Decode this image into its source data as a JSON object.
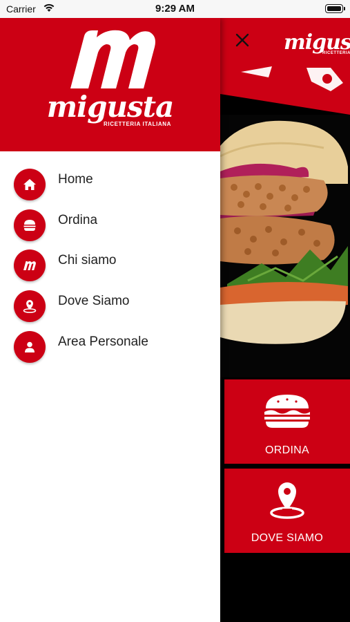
{
  "status_bar": {
    "carrier": "Carrier",
    "time": "9:29 AM"
  },
  "brand": {
    "primary_color": "#cc0014",
    "logo_mark": "m",
    "logo_word": "migusta",
    "logo_tagline": "RICETTERIA ITALIANA"
  },
  "drawer": {
    "menu": [
      {
        "label": "Home",
        "icon": "home-icon"
      },
      {
        "label": "Ordina",
        "icon": "burger-icon"
      },
      {
        "label": "Chi siamo",
        "icon": "logo-m-icon"
      },
      {
        "label": "Dove Siamo",
        "icon": "location-pin-icon"
      },
      {
        "label": "Area Personale",
        "icon": "user-icon"
      }
    ]
  },
  "main": {
    "close_icon": "close-icon",
    "tiles": [
      {
        "label": "ORDINA",
        "icon": "burger-icon"
      },
      {
        "label": "DOVE SIAMO",
        "icon": "location-pin-icon"
      }
    ]
  }
}
